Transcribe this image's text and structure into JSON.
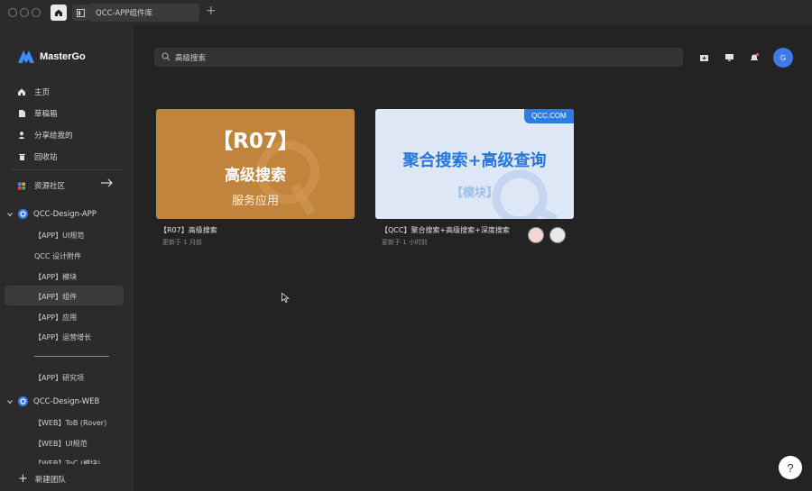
{
  "tabs": {
    "file_tab_label": "QCC-APP组件库"
  },
  "sidebar": {
    "brand": "MasterGo",
    "nav": [
      {
        "label": "主页",
        "icon": "home-icon"
      },
      {
        "label": "草稿箱",
        "icon": "file-icon"
      },
      {
        "label": "分享给我的",
        "icon": "user-icon"
      },
      {
        "label": "回收站",
        "icon": "trash-icon"
      }
    ],
    "community": "资源社区",
    "team1": {
      "name": "QCC-Design-APP",
      "items": [
        "【APP】UI规范",
        "QCC 设计附件",
        "【APP】模块",
        "【APP】组件",
        "【APP】应用",
        "【APP】运营增长",
        "【APP】研究项"
      ]
    },
    "team2": {
      "name": "QCC-Design-WEB",
      "items": [
        "【WEB】ToB (Rover)",
        "【WEB】UI规范",
        "【WEB】ToC (模块)"
      ]
    },
    "new_team": "新建团队"
  },
  "search": {
    "value": "高级搜索"
  },
  "user": {
    "avatar_letter": "G"
  },
  "cards": [
    {
      "thumb_big": "【R07】",
      "thumb_mid": "高级搜索",
      "thumb_small": "服务应用",
      "name": "【R07】高级搜索",
      "updated": "更新于 1 月前"
    },
    {
      "badge": "QCC.COM",
      "thumb_big": "聚合搜索+高级查询",
      "thumb_tag": "【模块】",
      "name": "【QCC】聚合搜索+高级搜索+深度搜索",
      "updated": "更新于 1 小时前"
    }
  ],
  "help_label": "?",
  "colors": {
    "accent": "#3f7ae8",
    "card1_bg": "#c0843d",
    "card2_bg": "#dde7f6",
    "badge": "#2b7de0"
  }
}
